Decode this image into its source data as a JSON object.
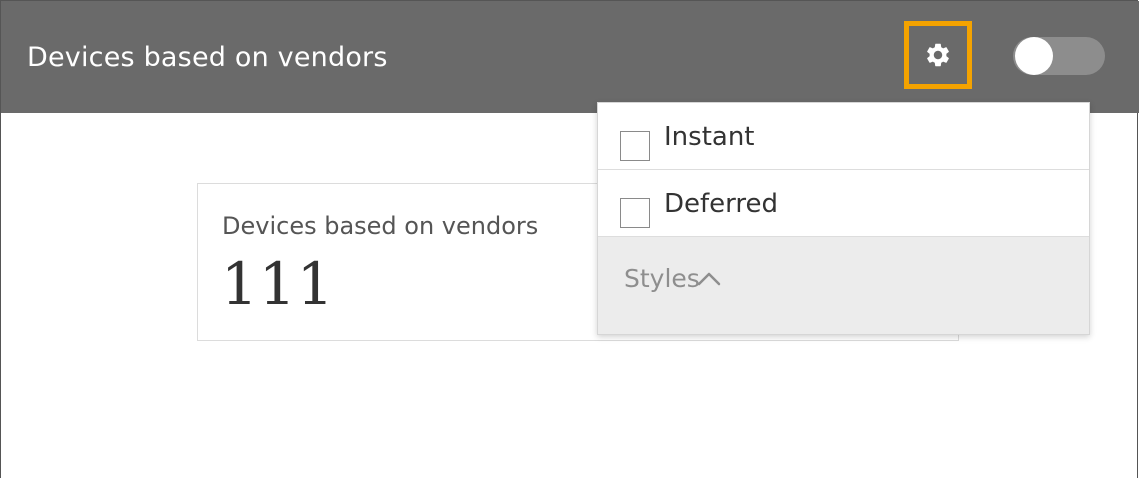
{
  "header": {
    "title": "Devices based on vendors",
    "settings_icon": "gear-icon",
    "toggle_state": "off",
    "highlight_color": "#f5a300",
    "header_color": "#6a6a6a"
  },
  "card": {
    "title": "Devices based on vendors",
    "value": "111"
  },
  "dropdown": {
    "options": [
      {
        "label": "Instant",
        "checked": false
      },
      {
        "label": "Deferred",
        "checked": false
      }
    ],
    "styles_label": "Styles",
    "styles_icon": "chevron-up-icon"
  }
}
